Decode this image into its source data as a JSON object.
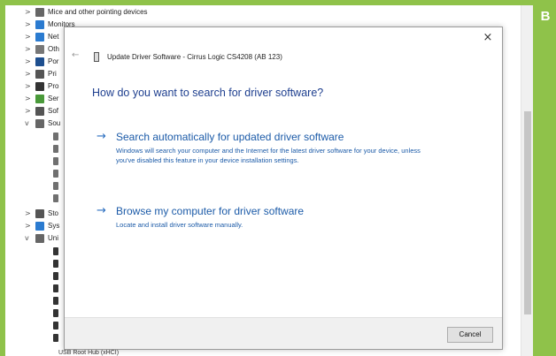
{
  "badge": "B",
  "device_manager": {
    "tree": [
      {
        "label": "Mice and other pointing devices",
        "expander": ">",
        "icon": "mouse-icon"
      },
      {
        "label": "Monitors",
        "expander": ">",
        "icon": "monitor-icon"
      },
      {
        "label": "Net",
        "expander": ">",
        "icon": "network-icon"
      },
      {
        "label": "Oth",
        "expander": ">",
        "icon": "other-devices-icon"
      },
      {
        "label": "Por",
        "expander": ">",
        "icon": "ports-icon"
      },
      {
        "label": "Pri",
        "expander": ">",
        "icon": "print-queue-icon"
      },
      {
        "label": "Pro",
        "expander": ">",
        "icon": "processor-icon"
      },
      {
        "label": "Ser",
        "expander": ">",
        "icon": "software-icon"
      },
      {
        "label": "Sof",
        "expander": ">",
        "icon": "software-device-icon"
      },
      {
        "label": "Sou",
        "expander": "v",
        "icon": "speaker-icon"
      },
      {
        "label": "Sto",
        "expander": ">",
        "icon": "storage-icon"
      },
      {
        "label": "Sys",
        "expander": ">",
        "icon": "system-icon"
      },
      {
        "label": "Uni",
        "expander": "v",
        "icon": "usb-icon"
      }
    ],
    "bottom_peek": "USB Root Hub (xHCI)"
  },
  "dialog": {
    "close_glyph": "×",
    "back_glyph": "←",
    "title": "Update Driver Software - Cirrus Logic CS4208 (AB 123)",
    "heading": "How do you want to search for driver software?",
    "options": [
      {
        "arrow": "→",
        "title": "Search automatically for updated driver software",
        "description": "Windows will search your computer and the Internet for the latest driver software for your device, unless you've disabled this feature in your device installation settings."
      },
      {
        "arrow": "→",
        "title": "Browse my computer for driver software",
        "description": "Locate and install driver software manually."
      }
    ],
    "cancel_label": "Cancel"
  },
  "colors": {
    "frame_green": "#8fc24a",
    "heading_blue": "#1e3f8f",
    "link_blue": "#1c5ba8"
  }
}
